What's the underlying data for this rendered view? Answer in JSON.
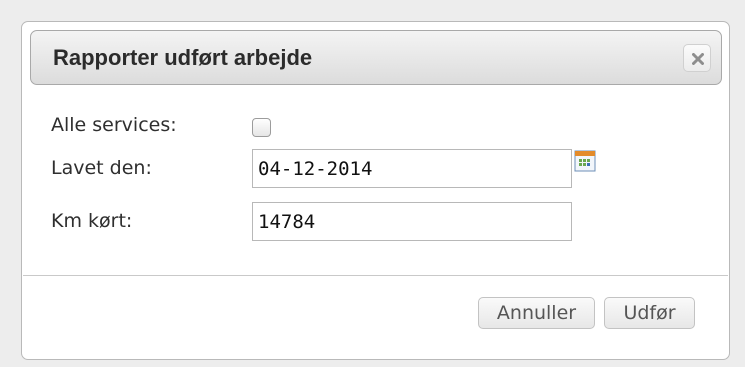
{
  "dialog": {
    "title": "Rapporter udført arbejde",
    "close_icon": "close-icon"
  },
  "form": {
    "all_services_label": "Alle services:",
    "all_services_checked": false,
    "done_date_label": "Lavet den:",
    "done_date_value": "04-12-2014",
    "calendar_icon": "calendar-icon",
    "km_label": "Km kørt:",
    "km_value": "14784"
  },
  "buttons": {
    "cancel_label": "Annuller",
    "submit_label": "Udfør"
  }
}
